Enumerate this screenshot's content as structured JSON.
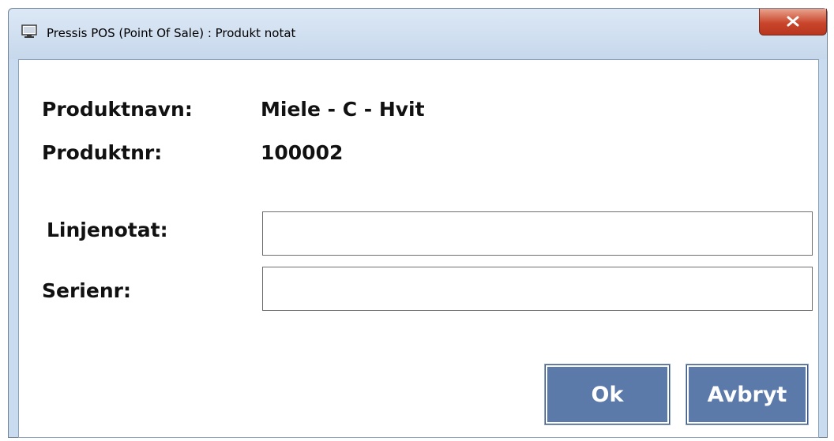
{
  "window": {
    "title": "Pressis POS (Point Of Sale) : Produkt notat",
    "close_label": "x"
  },
  "product": {
    "name_label": "Produktnavn:",
    "name_value": "Miele - C - Hvit",
    "number_label": "Produktnr:",
    "number_value": "100002"
  },
  "fields": {
    "line_note_label": "Linjenotat:",
    "line_note_value": "",
    "serial_label": "Serienr:",
    "serial_value": ""
  },
  "buttons": {
    "ok_label": "Ok",
    "cancel_label": "Avbryt"
  },
  "colors": {
    "button_fill": "#5b79a9",
    "close_button": "#c9462c",
    "title_bar": "#c7d8ec"
  },
  "icons": {
    "app": "monitor-icon",
    "close": "close-icon"
  }
}
